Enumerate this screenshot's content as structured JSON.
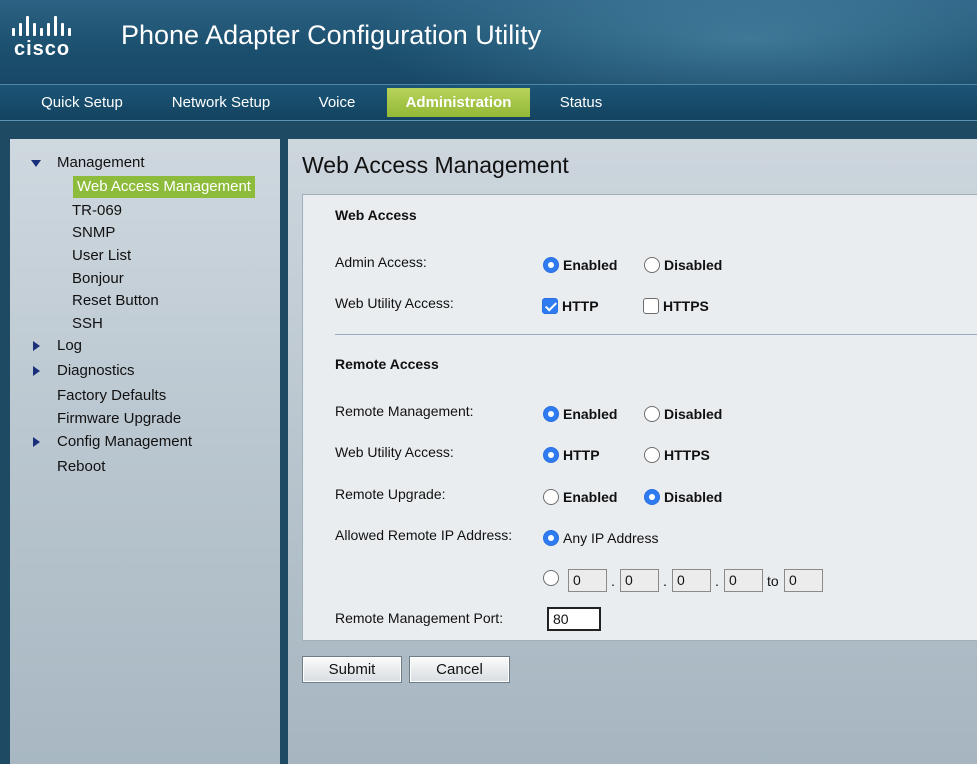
{
  "header": {
    "logo_text": "cisco",
    "title": "Phone Adapter Configuration Utility"
  },
  "nav": {
    "tabs": [
      {
        "label": "Quick Setup"
      },
      {
        "label": "Network Setup"
      },
      {
        "label": "Voice"
      },
      {
        "label": "Administration",
        "active": true
      },
      {
        "label": "Status"
      }
    ]
  },
  "sidebar": {
    "management": {
      "label": "Management",
      "expanded": true,
      "items": [
        {
          "label": "Web Access Management",
          "active": true
        },
        {
          "label": "TR-069"
        },
        {
          "label": "SNMP"
        },
        {
          "label": "User List"
        },
        {
          "label": "Bonjour"
        },
        {
          "label": "Reset Button"
        },
        {
          "label": "SSH"
        }
      ]
    },
    "items": [
      {
        "label": "Log",
        "collapsible": true
      },
      {
        "label": "Diagnostics",
        "collapsible": true
      },
      {
        "label": "Factory Defaults"
      },
      {
        "label": "Firmware Upgrade"
      },
      {
        "label": "Config Management",
        "collapsible": true
      },
      {
        "label": "Reboot"
      }
    ]
  },
  "main": {
    "title": "Web Access Management",
    "web_access": {
      "section_title": "Web Access",
      "admin_access": {
        "label": "Admin Access:",
        "options": [
          "Enabled",
          "Disabled"
        ],
        "selected": "Enabled"
      },
      "web_utility_access": {
        "label": "Web Utility Access:",
        "options": [
          "HTTP",
          "HTTPS"
        ],
        "checked": [
          "HTTP"
        ]
      }
    },
    "remote_access": {
      "section_title": "Remote Access",
      "remote_management": {
        "label": "Remote Management:",
        "options": [
          "Enabled",
          "Disabled"
        ],
        "selected": "Enabled"
      },
      "web_utility_access": {
        "label": "Web Utility Access:",
        "options": [
          "HTTP",
          "HTTPS"
        ],
        "selected": "HTTP"
      },
      "remote_upgrade": {
        "label": "Remote Upgrade:",
        "options": [
          "Enabled",
          "Disabled"
        ],
        "selected": "Disabled"
      },
      "allowed_ip": {
        "label": "Allowed Remote IP Address:",
        "any_label": "Any IP Address",
        "selected": "any",
        "range": {
          "octets": [
            "0",
            "0",
            "0",
            "0"
          ],
          "to_label": "to",
          "to_value": "0"
        }
      },
      "port": {
        "label": "Remote Management Port:",
        "value": "80"
      }
    },
    "buttons": {
      "submit": "Submit",
      "cancel": "Cancel"
    }
  },
  "colors": {
    "accent_green": "#93b836",
    "nav_blue": "#1c5577",
    "radio_blue": "#2f7bf1"
  }
}
